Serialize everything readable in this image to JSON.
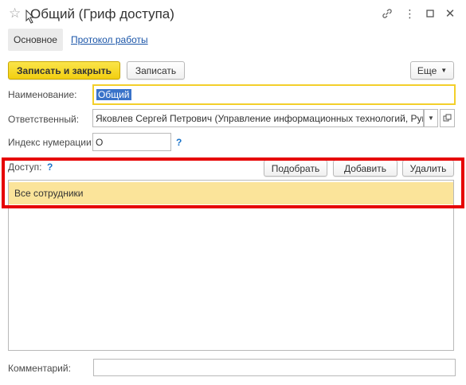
{
  "window": {
    "title": "Общий (Гриф доступа)",
    "icons": [
      "star-icon",
      "link-icon",
      "more-icon",
      "maximize-icon",
      "close-icon"
    ]
  },
  "tabs": [
    {
      "label": "Основное",
      "active": true
    },
    {
      "label": "Протокол работы",
      "active": false
    }
  ],
  "toolbar": {
    "save_close_label": "Записать и закрыть",
    "save_label": "Записать",
    "more_label": "Еще"
  },
  "form": {
    "name_label": "Наименование:",
    "name_value": "Общий",
    "responsible_label": "Ответственный:",
    "responsible_value": "Яковлев Сергей Петрович (Управление информационных технологий, Руковс",
    "index_label": "Индекс нумерации:",
    "index_value": "О",
    "help_mark": "?",
    "access_label": "Доступ:",
    "comment_label": "Комментарий:",
    "comment_value": ""
  },
  "access": {
    "pick_label": "Подобрать",
    "add_label": "Добавить",
    "delete_label": "Удалить",
    "rows": [
      "Все сотрудники"
    ]
  },
  "colors": {
    "primary_button": "#f2ce10",
    "selected_row": "#fbe49a",
    "highlight_frame": "#e60000",
    "link": "#1a55a8",
    "focus_border": "#f3cf2a"
  }
}
